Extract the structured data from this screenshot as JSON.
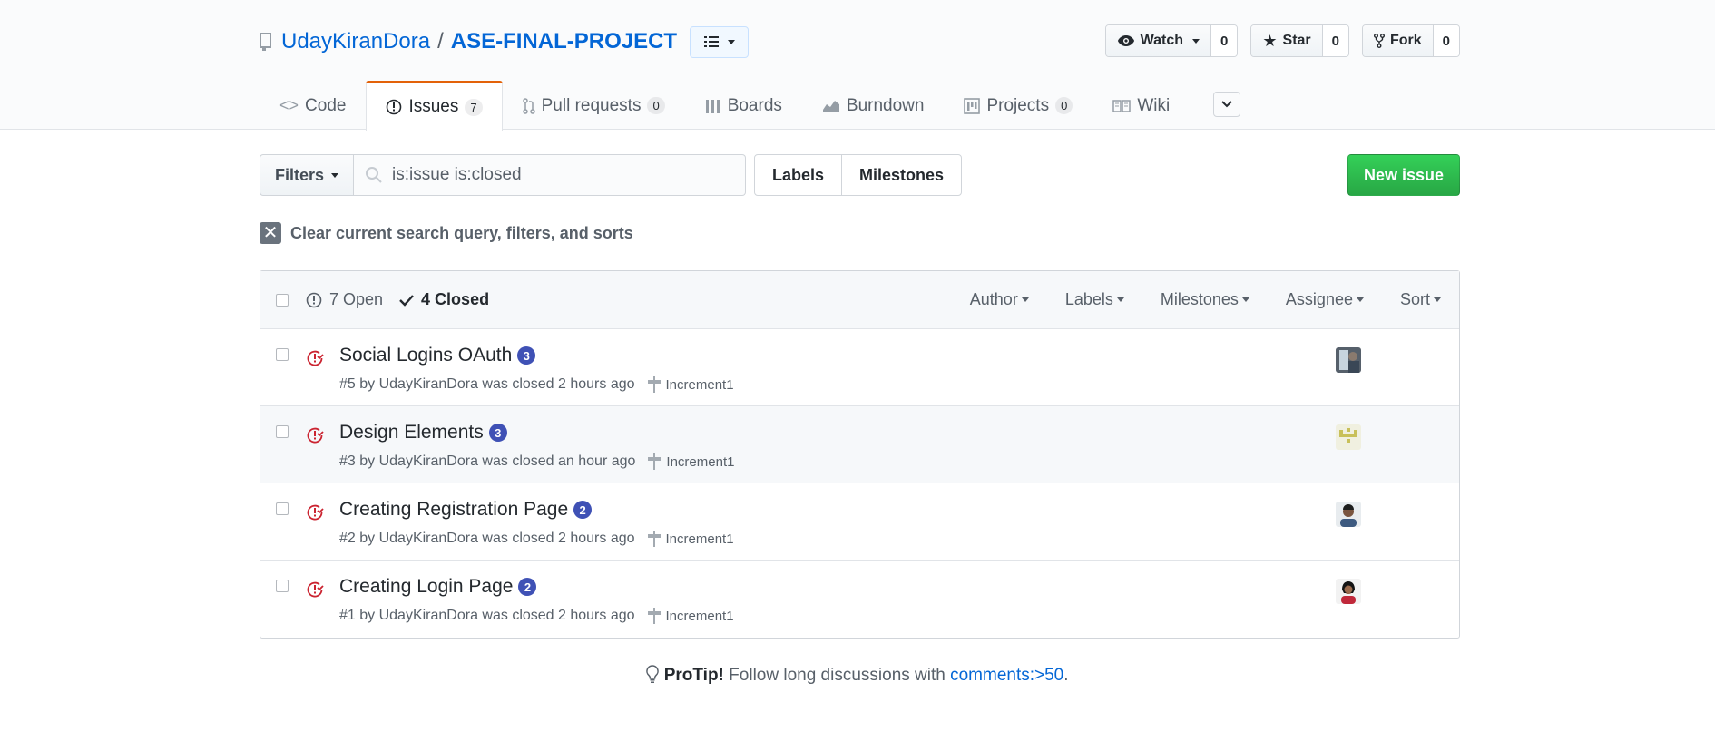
{
  "repo": {
    "owner": "UdayKiranDora",
    "separator": "/",
    "name": "ASE-FINAL-PROJECT"
  },
  "social": {
    "watch_label": "Watch",
    "watch_count": "0",
    "star_label": "Star",
    "star_count": "0",
    "fork_label": "Fork",
    "fork_count": "0"
  },
  "tabs": [
    {
      "label": "Code",
      "icon": "code-icon"
    },
    {
      "label": "Issues",
      "icon": "issue-opened-icon",
      "count": "7"
    },
    {
      "label": "Pull requests",
      "icon": "git-pull-request-icon",
      "count": "0"
    },
    {
      "label": "Boards",
      "icon": "boards-icon"
    },
    {
      "label": "Burndown",
      "icon": "graph-icon"
    },
    {
      "label": "Projects",
      "icon": "project-icon",
      "count": "0"
    },
    {
      "label": "Wiki",
      "icon": "book-icon"
    }
  ],
  "subnav": {
    "filters_label": "Filters",
    "search_value": "is:issue is:closed",
    "labels_label": "Labels",
    "milestones_label": "Milestones",
    "new_issue_label": "New issue"
  },
  "clear_text": "Clear current search query, filters, and sorts",
  "issues_header": {
    "open_label": "7 Open",
    "closed_label": "4 Closed",
    "author": "Author",
    "labels": "Labels",
    "milestones": "Milestones",
    "assignee": "Assignee",
    "sort": "Sort"
  },
  "issues": [
    {
      "title": "Social Logins OAuth",
      "comments": "3",
      "meta": "#5 by UdayKiranDora was closed 2 hours ago",
      "milestone": "Increment1"
    },
    {
      "title": "Design Elements",
      "comments": "3",
      "meta": "#3 by UdayKiranDora was closed an hour ago",
      "milestone": "Increment1"
    },
    {
      "title": "Creating Registration Page",
      "comments": "2",
      "meta": "#2 by UdayKiranDora was closed 2 hours ago",
      "milestone": "Increment1"
    },
    {
      "title": "Creating Login Page",
      "comments": "2",
      "meta": "#1 by UdayKiranDora was closed 2 hours ago",
      "milestone": "Increment1"
    }
  ],
  "protip": {
    "strong": "ProTip!",
    "text": " Follow long discussions with ",
    "link": "comments:>50",
    "end": "."
  },
  "colors": {
    "link": "#0366d6",
    "closed_icon": "#cb2431",
    "new_issue": "#28a745",
    "label_badge": "#3f51b5",
    "tab_active_border": "#e36209"
  }
}
